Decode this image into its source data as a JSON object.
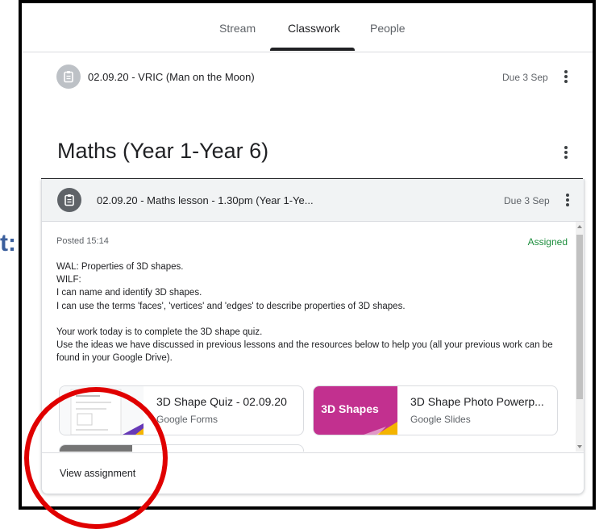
{
  "edge_glyph": "t:",
  "tabs": [
    {
      "label": "Stream"
    },
    {
      "label": "Classwork"
    },
    {
      "label": "People"
    }
  ],
  "active_tab": "Classwork",
  "previous_item": {
    "title": "02.09.20 - VRIC (Man on the Moon)",
    "due": "Due 3 Sep",
    "icon": "assignment-icon"
  },
  "topic": {
    "title": "Maths (Year 1-Year 6)"
  },
  "assignment": {
    "title": "02.09.20 - Maths lesson - 1.30pm (Year 1-Ye...",
    "due": "Due 3 Sep",
    "posted": "Posted 15:14",
    "status": "Assigned",
    "status_color": "#1e8e3e",
    "description": [
      "WAL: Properties of 3D shapes.",
      "WILF:",
      "I can name and identify 3D shapes.",
      "I can use the terms 'faces', 'vertices' and 'edges' to describe properties of 3D shapes.",
      "",
      "Your work today is to complete the 3D shape quiz.",
      "Use the ideas we have discussed in previous lessons and the resources below to help you (all your previous work can be found in your Google Drive)."
    ],
    "attachments": [
      {
        "title": "3D Shape Quiz - 02.09.20",
        "type": "Google Forms"
      },
      {
        "title": "3D Shape Photo Powerp...",
        "type": "Google Slides",
        "thumb_text": "3D Shapes"
      }
    ],
    "view_label": "View assignment"
  },
  "colors": {
    "forms_accent": "#673ab7",
    "slides_accent": "#f4b400",
    "slides_thumb": "#c2308f",
    "annotation": "#e00000"
  }
}
